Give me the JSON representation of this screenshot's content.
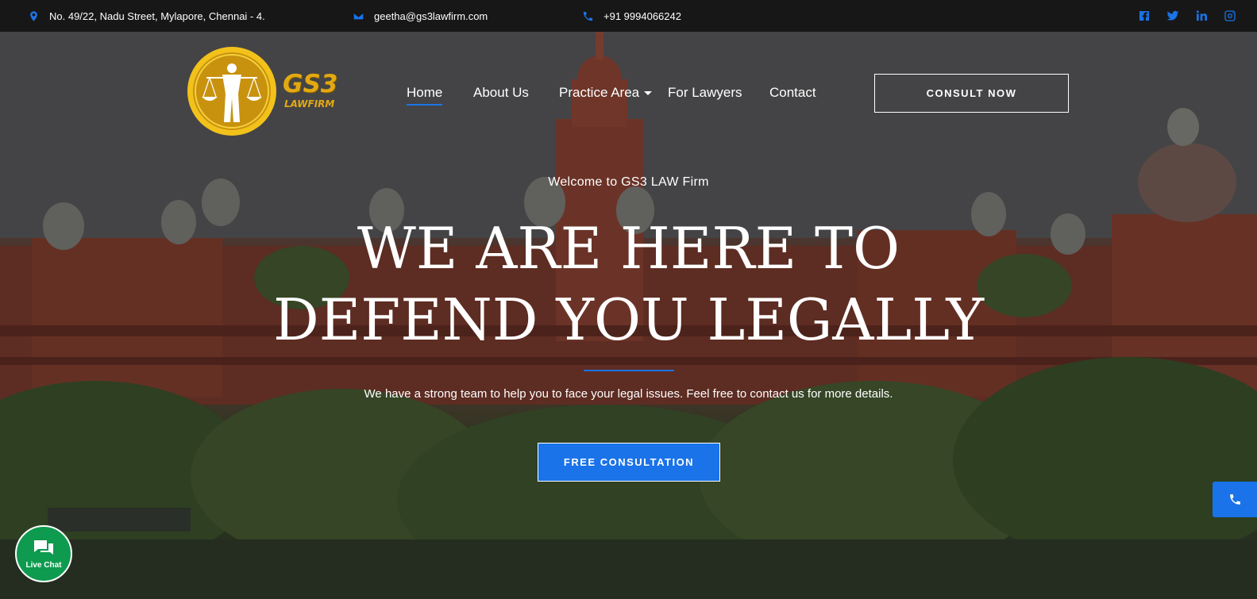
{
  "topbar": {
    "address": "No. 49/22, Nadu Street, Mylapore, Chennai - 4.",
    "email": "geetha@gs3lawfirm.com",
    "phone": "+91 9994066242",
    "social_icons": [
      "facebook-icon",
      "twitter-icon",
      "linkedin-icon",
      "instagram-icon"
    ]
  },
  "logo": {
    "text": "GS3",
    "subtext": "LAWFIRM"
  },
  "nav": {
    "items": [
      "Home",
      "About Us",
      "Practice Area",
      "For Lawyers",
      "Contact"
    ],
    "active": "Home"
  },
  "header": {
    "consult_label": "CONSULT NOW"
  },
  "hero": {
    "welcome": "Welcome to GS3 LAW Firm",
    "headline_line1": "WE ARE HERE TO",
    "headline_line2": "DEFEND YOU LEGALLY",
    "subtext": "We have a strong team to help you to face your legal issues. Feel free to contact us for more details.",
    "cta_label": "FREE CONSULTATION"
  },
  "widgets": {
    "live_chat_label": "Live Chat"
  },
  "colors": {
    "accent": "#1a73e8",
    "topbar": "#171717",
    "live_chat": "#0e9a4f",
    "logo_gold": "#d4a017"
  }
}
